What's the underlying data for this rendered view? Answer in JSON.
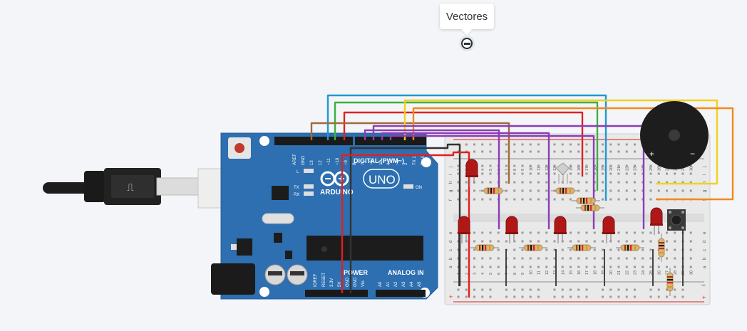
{
  "tooltip": {
    "label": "Vectores"
  },
  "board": {
    "brand": "ARDUINO",
    "model": "UNO",
    "digital_label": "DIGITAL (PWM~)",
    "power_label": "POWER",
    "analog_label": "ANALOG IN",
    "on_label": "ON",
    "l_label": "L",
    "tx_label": "TX",
    "rx_label": "RX",
    "top_pins": [
      "AREF",
      "GND",
      "13",
      "12",
      "~11",
      "~10",
      "~9",
      "8",
      "7",
      "~6",
      "~5",
      "4",
      "~3",
      "2",
      "TX 1",
      "RX 0"
    ],
    "power_pins": [
      "IOREF",
      "RESET",
      "3.3V",
      "5V",
      "GND",
      "GND",
      "Vin"
    ],
    "analog_pins": [
      "A0",
      "A1",
      "A2",
      "A3",
      "A4",
      "A5"
    ]
  },
  "breadboard": {
    "col_numbers": [
      "1",
      "2",
      "3",
      "4",
      "5",
      "6",
      "7",
      "8",
      "9",
      "10",
      "11",
      "12",
      "13",
      "14",
      "15",
      "16",
      "17",
      "18",
      "19",
      "20",
      "21",
      "22",
      "23",
      "24",
      "25",
      "26",
      "27",
      "28",
      "29",
      "30"
    ],
    "row_letters_top": [
      "j",
      "i",
      "h",
      "g",
      "f"
    ],
    "row_letters_bottom": [
      "e",
      "d",
      "c",
      "b",
      "a"
    ],
    "plus": "+",
    "minus": "−"
  },
  "buzzer": {
    "plus": "+",
    "minus": "−"
  },
  "colors": {
    "board": "#2d6fb0",
    "wire_red": "#e02020",
    "wire_blue": "#1e9ad0",
    "wire_green": "#3cb043",
    "wire_yellow": "#f2d21e",
    "wire_orange": "#f08a1c",
    "wire_brown": "#a06a3c",
    "wire_purple": "#8a3db5",
    "wire_black": "#333333"
  }
}
